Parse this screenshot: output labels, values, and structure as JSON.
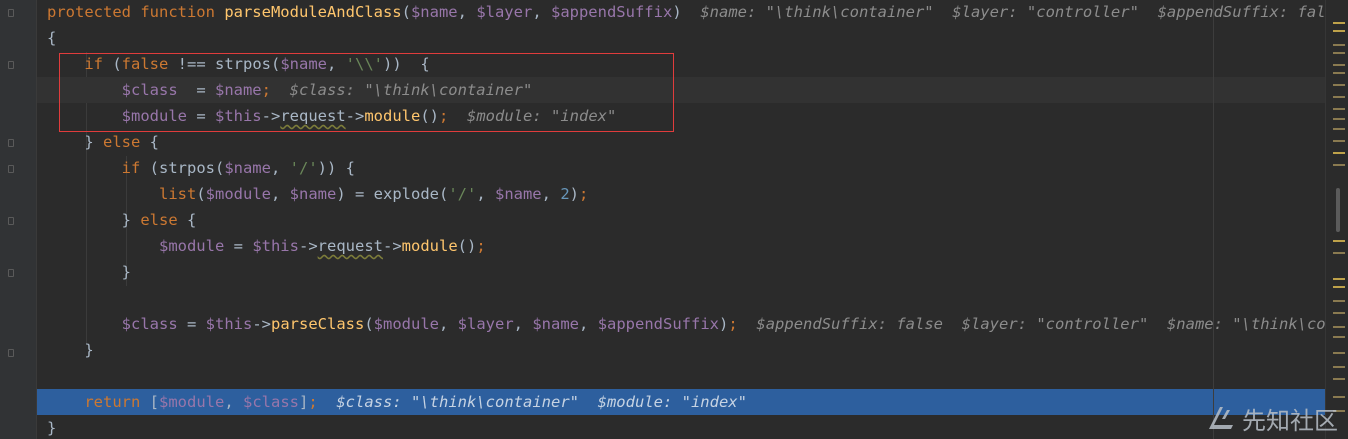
{
  "lines": [
    {
      "kind": "normal",
      "tokens": [
        [
          "kw",
          "protected function "
        ],
        [
          "fn",
          "parseModuleAndClass"
        ],
        [
          "pl",
          "("
        ],
        [
          "var",
          "$name"
        ],
        [
          "pl",
          ", "
        ],
        [
          "var",
          "$layer"
        ],
        [
          "pl",
          ", "
        ],
        [
          "var",
          "$appendSuffix"
        ],
        [
          "pl",
          ")"
        ],
        [
          "hint",
          "  $name: \"\\think\\container\"  $layer: \"controller\"  $appendSuffix: false"
        ]
      ]
    },
    {
      "kind": "normal",
      "tokens": [
        [
          "pl",
          "{"
        ]
      ]
    },
    {
      "kind": "normal",
      "tokens": [
        [
          "pl",
          "    "
        ],
        [
          "kw",
          "if "
        ],
        [
          "pl",
          "("
        ],
        [
          "kw",
          "false "
        ],
        [
          "pl",
          "!== strpos("
        ],
        [
          "var",
          "$name"
        ],
        [
          "pl",
          ", "
        ],
        [
          "str",
          "'\\\\'"
        ],
        [
          "pl",
          "))  {"
        ]
      ]
    },
    {
      "kind": "caret",
      "tokens": [
        [
          "pl",
          "        "
        ],
        [
          "var",
          "$class"
        ],
        [
          "pl",
          "  = "
        ],
        [
          "var",
          "$name"
        ],
        [
          "kw",
          ";"
        ],
        [
          "hint",
          "  $class: \"\\think\\container\""
        ]
      ]
    },
    {
      "kind": "normal",
      "tokens": [
        [
          "pl",
          "        "
        ],
        [
          "var",
          "$module"
        ],
        [
          "pl",
          " = "
        ],
        [
          "var",
          "$this"
        ],
        [
          "pl",
          "->"
        ],
        [
          "wavy",
          "request"
        ],
        [
          "pl",
          "->"
        ],
        [
          "fn",
          "module"
        ],
        [
          "pl",
          "()"
        ],
        [
          "kw",
          ";"
        ],
        [
          "hint",
          "  $module: \"index\""
        ]
      ]
    },
    {
      "kind": "normal",
      "tokens": [
        [
          "pl",
          "    } "
        ],
        [
          "kw",
          "else "
        ],
        [
          "pl",
          "{"
        ]
      ]
    },
    {
      "kind": "normal",
      "tokens": [
        [
          "pl",
          "        "
        ],
        [
          "kw",
          "if "
        ],
        [
          "pl",
          "(strpos("
        ],
        [
          "var",
          "$name"
        ],
        [
          "pl",
          ", "
        ],
        [
          "str",
          "'/'"
        ],
        [
          "pl",
          ")) {"
        ]
      ]
    },
    {
      "kind": "normal",
      "tokens": [
        [
          "pl",
          "            "
        ],
        [
          "kw",
          "list"
        ],
        [
          "pl",
          "("
        ],
        [
          "var",
          "$module"
        ],
        [
          "pl",
          ", "
        ],
        [
          "var",
          "$name"
        ],
        [
          "pl",
          ") = explode("
        ],
        [
          "str",
          "'/'"
        ],
        [
          "pl",
          ", "
        ],
        [
          "var",
          "$name"
        ],
        [
          "pl",
          ", "
        ],
        [
          "num",
          "2"
        ],
        [
          "pl",
          ")"
        ],
        [
          "kw",
          ";"
        ]
      ]
    },
    {
      "kind": "normal",
      "tokens": [
        [
          "pl",
          "        } "
        ],
        [
          "kw",
          "else "
        ],
        [
          "pl",
          "{"
        ]
      ]
    },
    {
      "kind": "normal",
      "tokens": [
        [
          "pl",
          "            "
        ],
        [
          "var",
          "$module"
        ],
        [
          "pl",
          " = "
        ],
        [
          "var",
          "$this"
        ],
        [
          "pl",
          "->"
        ],
        [
          "wavy",
          "request"
        ],
        [
          "pl",
          "->"
        ],
        [
          "fn",
          "module"
        ],
        [
          "pl",
          "()"
        ],
        [
          "kw",
          ";"
        ]
      ]
    },
    {
      "kind": "normal",
      "tokens": [
        [
          "pl",
          "        }"
        ]
      ]
    },
    {
      "kind": "normal",
      "tokens": [
        [
          "pl",
          ""
        ]
      ]
    },
    {
      "kind": "normal",
      "tokens": [
        [
          "pl",
          "        "
        ],
        [
          "var",
          "$class"
        ],
        [
          "pl",
          " = "
        ],
        [
          "var",
          "$this"
        ],
        [
          "pl",
          "->"
        ],
        [
          "fn",
          "parseClass"
        ],
        [
          "pl",
          "("
        ],
        [
          "var",
          "$module"
        ],
        [
          "pl",
          ", "
        ],
        [
          "var",
          "$layer"
        ],
        [
          "pl",
          ", "
        ],
        [
          "var",
          "$name"
        ],
        [
          "pl",
          ", "
        ],
        [
          "var",
          "$appendSuffix"
        ],
        [
          "pl",
          ")"
        ],
        [
          "kw",
          ";"
        ],
        [
          "hint",
          "  $appendSuffix: false  $layer: \"controller\"  $name: \"\\think\\container\""
        ]
      ]
    },
    {
      "kind": "normal",
      "tokens": [
        [
          "pl",
          "    }"
        ]
      ]
    },
    {
      "kind": "normal",
      "tokens": [
        [
          "pl",
          ""
        ]
      ]
    },
    {
      "kind": "exec",
      "tokens": [
        [
          "pl",
          "    "
        ],
        [
          "kw",
          "return "
        ],
        [
          "pl",
          "["
        ],
        [
          "var",
          "$module"
        ],
        [
          "pl",
          ", "
        ],
        [
          "var",
          "$class"
        ],
        [
          "pl",
          "]"
        ],
        [
          "kw",
          ";"
        ],
        [
          "hint",
          "  $class: \"\\think\\container\"  $module: \"index\""
        ]
      ]
    },
    {
      "kind": "normal",
      "tokens": [
        [
          "pl",
          "}"
        ]
      ]
    }
  ],
  "watermark": {
    "text": "先知社区"
  }
}
